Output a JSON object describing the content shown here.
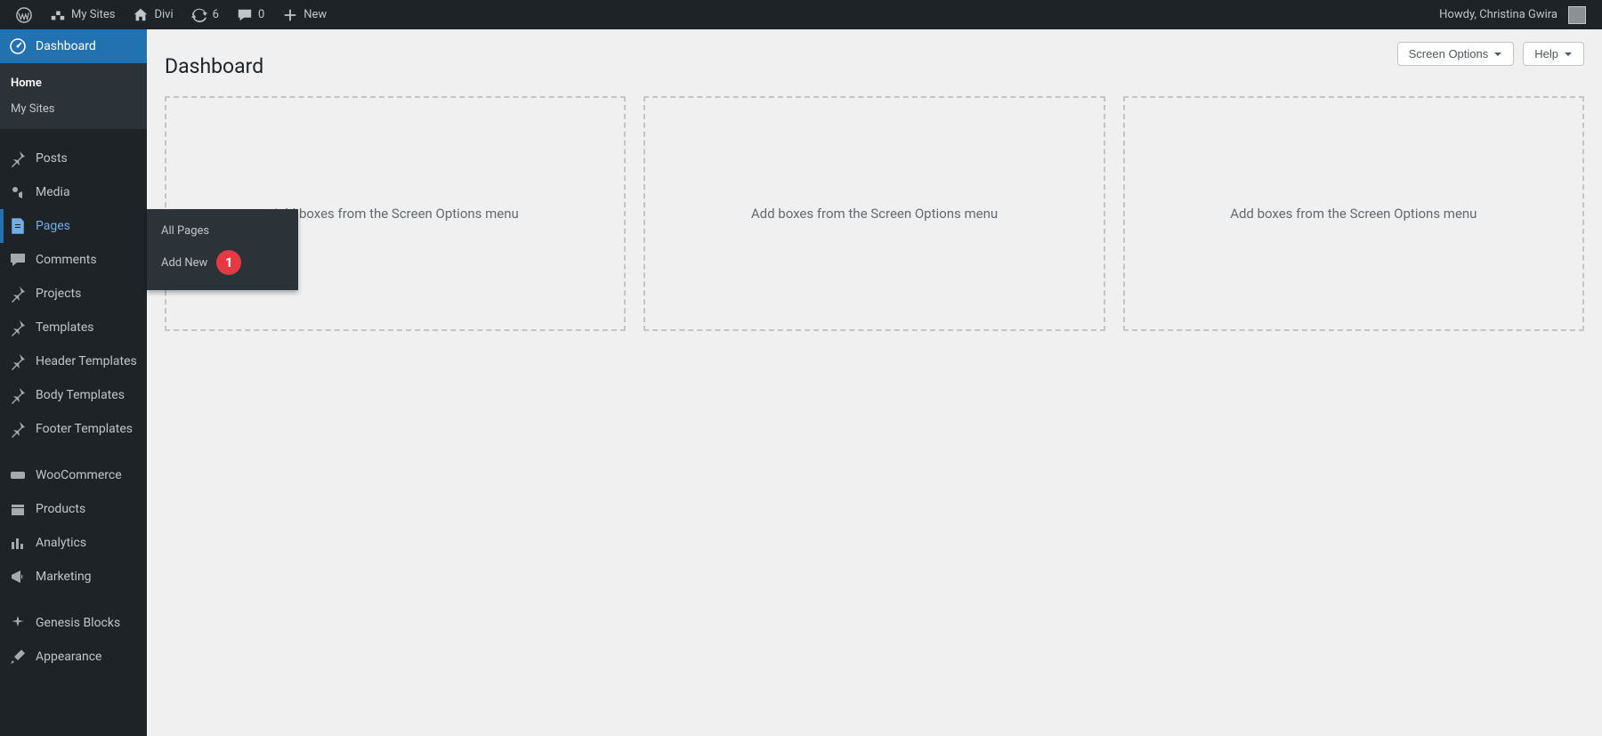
{
  "adminbar": {
    "mysites": "My Sites",
    "sitename": "Divi",
    "updates": "6",
    "comments": "0",
    "newlabel": "New",
    "howdy": "Howdy, Christina Gwira"
  },
  "sidebar": {
    "dashboard": "Dashboard",
    "dashboard_sub": {
      "home": "Home",
      "mysites": "My Sites"
    },
    "posts": "Posts",
    "media": "Media",
    "pages": "Pages",
    "pages_sub": {
      "all": "All Pages",
      "addnew": "Add New",
      "marker": "1"
    },
    "comments": "Comments",
    "projects": "Projects",
    "templates": "Templates",
    "header_templates": "Header Templates",
    "body_templates": "Body Templates",
    "footer_templates": "Footer Templates",
    "woocommerce": "WooCommerce",
    "products": "Products",
    "analytics": "Analytics",
    "marketing": "Marketing",
    "genesis_blocks": "Genesis Blocks",
    "appearance": "Appearance"
  },
  "content": {
    "title": "Dashboard",
    "screen_options": "Screen Options",
    "help": "Help",
    "empty_box": "Add boxes from the Screen Options menu"
  }
}
